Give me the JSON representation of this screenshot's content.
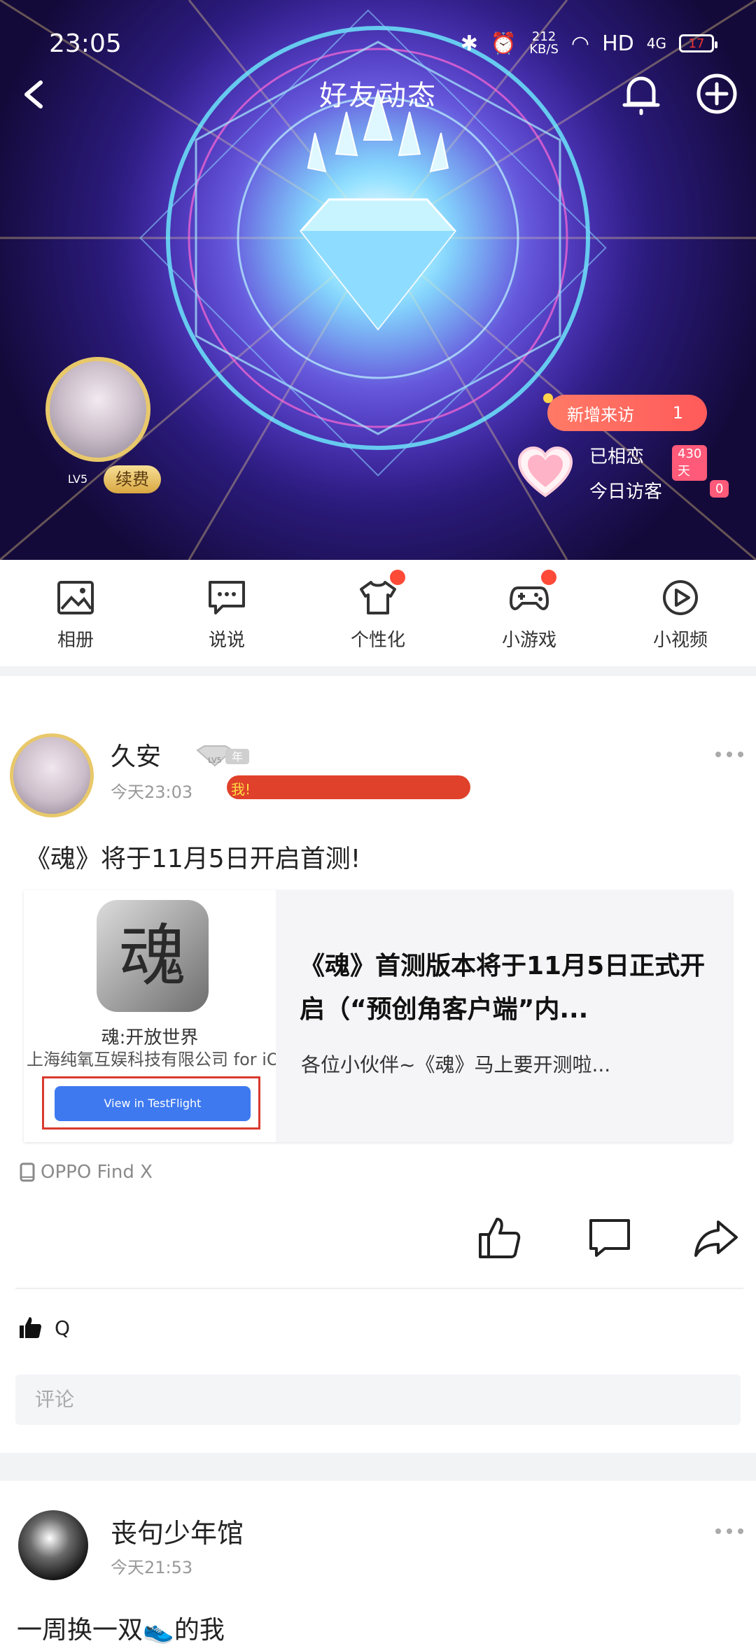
{
  "status_bar": {
    "time": "23:05",
    "net_speed": "212",
    "net_unit": "KB/S",
    "hd": "HD",
    "signal": "4G",
    "battery": "17"
  },
  "header": {
    "title": "好友动态",
    "new_visitors_label": "新增来访",
    "new_visitors_count": "1",
    "mutual_label": "已相恋",
    "mutual_days": "430天",
    "today_visits_label": "今日访客",
    "today_visits_count": "0",
    "renew_label": "续费",
    "level": "LV5"
  },
  "quick_nav": [
    {
      "label": "相册",
      "icon": "album-icon",
      "dot": false
    },
    {
      "label": "说说",
      "icon": "chat-icon",
      "dot": false
    },
    {
      "label": "个性化",
      "icon": "shirt-icon",
      "dot": true
    },
    {
      "label": "小游戏",
      "icon": "gamepad-icon",
      "dot": true
    },
    {
      "label": "小视频",
      "icon": "play-icon",
      "dot": false
    }
  ],
  "post1": {
    "author": "久安",
    "vip_badge": "年",
    "vip_level": "LV5",
    "time": "今天23:03",
    "tag": "我!",
    "text": "《魂》将于11月5日开启首测!",
    "card": {
      "icon_char": "魂",
      "app_name": "魂:开放世界",
      "developer": "上海纯氧互娱科技有限公司 for iOS",
      "testflight_button": "View in TestFlight",
      "title": "《魂》首测版本将于11月5日正式开启（“预创角客户端”内...",
      "desc": "各位小伙伴~《魂》马上要开测啦..."
    },
    "device": "OPPO Find X",
    "likes": "Q",
    "comment_placeholder": "评论"
  },
  "post2": {
    "author": "丧句少年馆",
    "time": "今天21:53",
    "text": "一周换一双👟的我"
  }
}
